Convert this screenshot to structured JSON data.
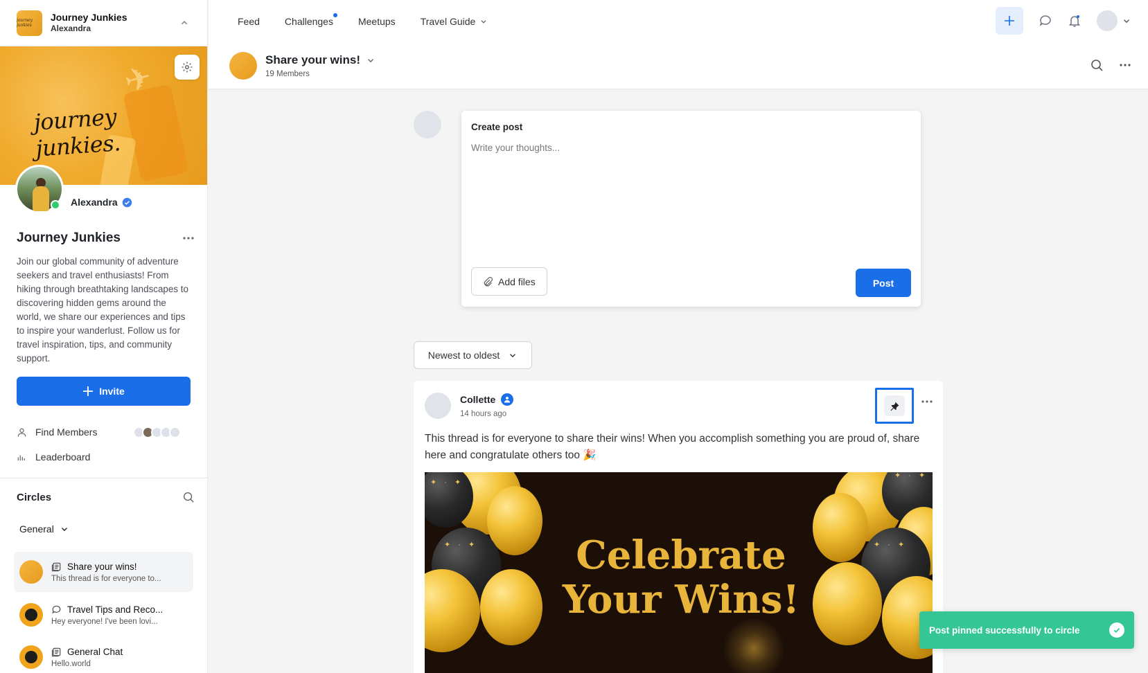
{
  "sidebar": {
    "community_name": "Journey Junkies",
    "user_name": "Alexandra",
    "logo_text": "journey junkies",
    "banner_script": "journey junkies.",
    "profile_name": "Alexandra",
    "title": "Journey Junkies",
    "description": "Join our global community of adventure seekers and travel enthusiasts! From hiking through breathtaking landscapes to discovering hidden gems around the world, we share our experiences and tips to inspire your wanderlust. Follow us for travel inspiration, tips, and community support.",
    "invite_label": "Invite",
    "find_members": "Find Members",
    "leaderboard": "Leaderboard",
    "circles_heading": "Circles",
    "general_label": "General",
    "circles": [
      {
        "name": "Share your wins!",
        "preview": "This thread is for everyone to...",
        "icon": "post-list-icon",
        "active": true
      },
      {
        "name": "Travel Tips and Reco...",
        "preview": "Hey everyone! I've been lovi...",
        "icon": "chat-bubble-icon",
        "active": false
      },
      {
        "name": "General Chat",
        "preview": "Hello.world",
        "icon": "post-list-icon",
        "active": false
      }
    ]
  },
  "topnav": {
    "items": [
      "Feed",
      "Challenges",
      "Meetups",
      "Travel Guide"
    ]
  },
  "circle_header": {
    "title": "Share your wins!",
    "members": "19 Members"
  },
  "compose": {
    "heading": "Create post",
    "placeholder": "Write your thoughts...",
    "add_files": "Add files",
    "post_label": "Post"
  },
  "sort": {
    "selected": "Newest to oldest"
  },
  "post": {
    "author": "Collette",
    "time": "14 hours ago",
    "body": "This thread is for everyone to share their wins! When you accomplish something you are proud of, share here and congratulate others too 🎉",
    "image_text": "Celebrate Your Wins!"
  },
  "toast": {
    "message": "Post pinned successfully to circle"
  },
  "colors": {
    "accent": "#1a6ee8",
    "toast": "#34c795",
    "online": "#2fcc71"
  }
}
